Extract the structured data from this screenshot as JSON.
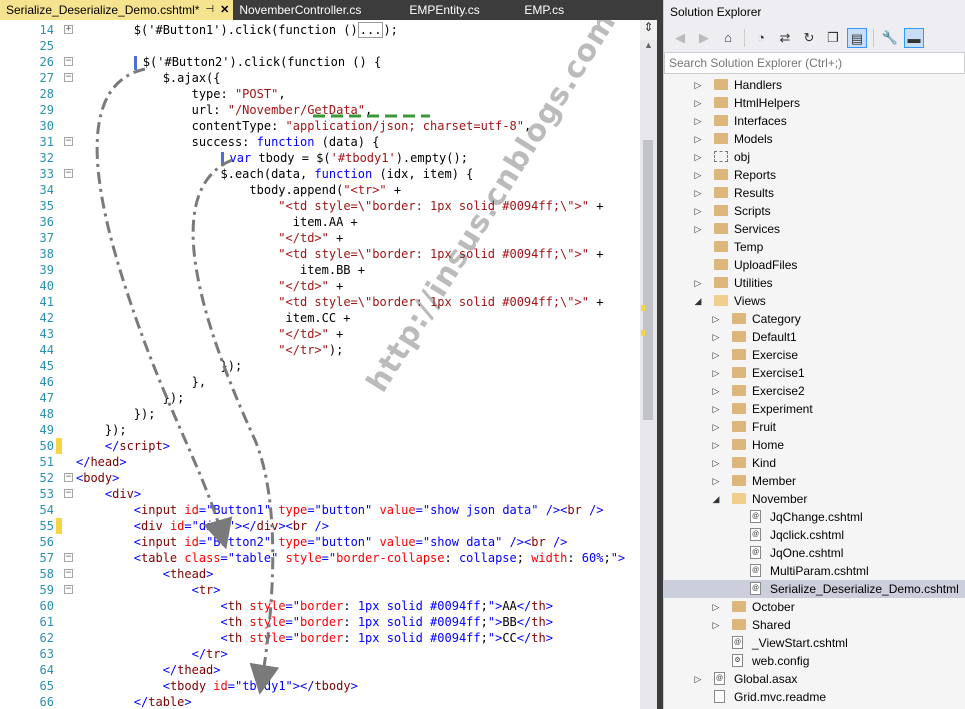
{
  "tabs": [
    {
      "label": "Serialize_Deserialize_Demo.cshtml*",
      "active": true
    },
    {
      "label": "NovemberController.cs"
    },
    {
      "label": "EMPEntity.cs"
    },
    {
      "label": "EMP.cs"
    }
  ],
  "editor": {
    "lines": [
      {
        "n": "14",
        "fold": "+",
        "html": "        $('#Button1').click(function ()<span class=\"box\">...</span>);"
      },
      {
        "n": "25",
        "fold": "",
        "html": ""
      },
      {
        "n": "26",
        "fold": "-",
        "html": "        <span class=\"caret\"></span>$('#Button2').click(function () {"
      },
      {
        "n": "27",
        "fold": "-",
        "html": "            $.ajax({"
      },
      {
        "n": "28",
        "fold": "",
        "html": "                type: <span class=\"s\">\"POST\"</span>,"
      },
      {
        "n": "29",
        "fold": "",
        "html": "                url: <span class=\"s\">\"/November/GetData\"</span>,"
      },
      {
        "n": "30",
        "fold": "",
        "html": "                contentType: <span class=\"s\">\"application/json; charset=utf-8\"</span>,"
      },
      {
        "n": "31",
        "fold": "-",
        "html": "                success: <span class=\"k\">function</span> (data) {"
      },
      {
        "n": "32",
        "fold": "",
        "html": "                    <span class=\"caret\"></span><span class=\"k\">var</span> tbody = $(<span class=\"s\">'#tbody1'</span>).empty();"
      },
      {
        "n": "33",
        "fold": "-",
        "html": "                    $.each(data, <span class=\"k\">function</span> (idx, item) {"
      },
      {
        "n": "34",
        "fold": "",
        "html": "                        tbody.append(<span class=\"s\">\"&lt;tr&gt;\"</span> +"
      },
      {
        "n": "35",
        "fold": "",
        "html": "                            <span class=\"s\">\"&lt;td style=\\\"border: 1px solid #0094ff;\\\"&gt;\"</span> +"
      },
      {
        "n": "36",
        "fold": "",
        "html": "                              item.AA +"
      },
      {
        "n": "37",
        "fold": "",
        "html": "                            <span class=\"s\">\"&lt;/td&gt;\"</span> +"
      },
      {
        "n": "38",
        "fold": "",
        "html": "                            <span class=\"s\">\"&lt;td style=\\\"border: 1px solid #0094ff;\\\"&gt;\"</span> +"
      },
      {
        "n": "39",
        "fold": "",
        "html": "                               item.BB +"
      },
      {
        "n": "40",
        "fold": "",
        "html": "                            <span class=\"s\">\"&lt;/td&gt;\"</span> +"
      },
      {
        "n": "41",
        "fold": "",
        "html": "                            <span class=\"s\">\"&lt;td style=\\\"border: 1px solid #0094ff;\\\"&gt;\"</span> +"
      },
      {
        "n": "42",
        "fold": "",
        "html": "                             item.CC +"
      },
      {
        "n": "43",
        "fold": "",
        "html": "                            <span class=\"s\">\"&lt;/td&gt;\"</span> +"
      },
      {
        "n": "44",
        "fold": "",
        "html": "                            <span class=\"s\">\"&lt;/tr&gt;\"</span>);"
      },
      {
        "n": "45",
        "fold": "",
        "html": "                    });"
      },
      {
        "n": "46",
        "fold": "",
        "html": "                },"
      },
      {
        "n": "47",
        "fold": "",
        "html": "            });"
      },
      {
        "n": "48",
        "fold": "",
        "html": "        });"
      },
      {
        "n": "49",
        "fold": "",
        "html": "    });"
      },
      {
        "n": "50",
        "fold": "",
        "mark": "#f5d547",
        "html": "    <span class=\"k\">&lt;/</span><span class=\"t\">script</span><span class=\"k\">&gt;</span>"
      },
      {
        "n": "51",
        "fold": "",
        "html": "<span class=\"k\">&lt;/</span><span class=\"t\">head</span><span class=\"k\">&gt;</span>"
      },
      {
        "n": "52",
        "fold": "-",
        "html": "<span class=\"k\">&lt;</span><span class=\"t\">body</span><span class=\"k\">&gt;</span>"
      },
      {
        "n": "53",
        "fold": "-",
        "html": "    <span class=\"k\">&lt;</span><span class=\"t\">div</span><span class=\"k\">&gt;</span>"
      },
      {
        "n": "54",
        "fold": "",
        "html": "        <span class=\"k\">&lt;</span><span class=\"t\">input</span> <span class=\"a\">id</span><span class=\"k\">=\"Button1\"</span> <span class=\"a\">type</span><span class=\"k\">=\"button\"</span> <span class=\"a\">value</span><span class=\"k\">=\"show json data\"</span> <span class=\"k\">/&gt;&lt;</span><span class=\"t\">br</span> <span class=\"k\">/&gt;</span>"
      },
      {
        "n": "55",
        "fold": "",
        "mark": "#f5d547",
        "html": "        <span class=\"k\">&lt;</span><span class=\"t\">div</span> <span class=\"a\">id</span><span class=\"k\">=\"div1\"&gt;&lt;/</span><span class=\"t\">div</span><span class=\"k\">&gt;&lt;</span><span class=\"t\">br</span> <span class=\"k\">/&gt;</span>"
      },
      {
        "n": "56",
        "fold": "",
        "html": "        <span class=\"k\">&lt;</span><span class=\"t\">input</span> <span class=\"a\">id</span><span class=\"k\">=\"Button2\"</span> <span class=\"a\">type</span><span class=\"k\">=\"button\"</span> <span class=\"a\">value</span><span class=\"k\">=\"show data\"</span> <span class=\"k\">/&gt;&lt;</span><span class=\"t\">br</span> <span class=\"k\">/&gt;</span>"
      },
      {
        "n": "57",
        "fold": "-",
        "html": "        <span class=\"k\">&lt;</span><span class=\"t\">table</span> <span class=\"a\">class</span><span class=\"k\">=\"table\"</span> <span class=\"a\">style</span><span class=\"k\">=\"</span><span class=\"a\">border-collapse</span>: <span class=\"k\">collapse</span>; <span class=\"a\">width</span>: <span class=\"k\">60%</span>;<span class=\"k\">\"&gt;</span>"
      },
      {
        "n": "58",
        "fold": "-",
        "html": "            <span class=\"k\">&lt;</span><span class=\"t\">thead</span><span class=\"k\">&gt;</span>"
      },
      {
        "n": "59",
        "fold": "-",
        "html": "                <span class=\"k\">&lt;</span><span class=\"t\">tr</span><span class=\"k\">&gt;</span>"
      },
      {
        "n": "60",
        "fold": "",
        "html": "                    <span class=\"k\">&lt;</span><span class=\"t\">th</span> <span class=\"a\">style</span><span class=\"k\">=\"</span><span class=\"a\">border</span>: <span class=\"k\">1px solid #0094ff</span>;<span class=\"k\">\"&gt;</span>AA<span class=\"k\">&lt;/</span><span class=\"t\">th</span><span class=\"k\">&gt;</span>"
      },
      {
        "n": "61",
        "fold": "",
        "html": "                    <span class=\"k\">&lt;</span><span class=\"t\">th</span> <span class=\"a\">style</span><span class=\"k\">=\"</span><span class=\"a\">border</span>: <span class=\"k\">1px solid #0094ff</span>;<span class=\"k\">\"&gt;</span>BB<span class=\"k\">&lt;/</span><span class=\"t\">th</span><span class=\"k\">&gt;</span>"
      },
      {
        "n": "62",
        "fold": "",
        "html": "                    <span class=\"k\">&lt;</span><span class=\"t\">th</span> <span class=\"a\">style</span><span class=\"k\">=\"</span><span class=\"a\">border</span>: <span class=\"k\">1px solid #0094ff</span>;<span class=\"k\">\"&gt;</span>CC<span class=\"k\">&lt;/</span><span class=\"t\">th</span><span class=\"k\">&gt;</span>"
      },
      {
        "n": "63",
        "fold": "",
        "html": "                <span class=\"k\">&lt;/</span><span class=\"t\">tr</span><span class=\"k\">&gt;</span>"
      },
      {
        "n": "64",
        "fold": "",
        "html": "            <span class=\"k\">&lt;/</span><span class=\"t\">thead</span><span class=\"k\">&gt;</span>"
      },
      {
        "n": "65",
        "fold": "",
        "html": "            <span class=\"k\">&lt;</span><span class=\"t\">tbody</span> <span class=\"a\">id</span><span class=\"k\">=\"tbody1\"&gt;&lt;/</span><span class=\"t\">tbody</span><span class=\"k\">&gt;</span>"
      },
      {
        "n": "66",
        "fold": "",
        "html": "        <span class=\"k\">&lt;/</span><span class=\"t\">table</span><span class=\"k\">&gt;</span>"
      }
    ]
  },
  "watermark": "http://insus.cnblogs.com",
  "solution_explorer": {
    "title": "Solution Explorer",
    "search_placeholder": "Search Solution Explorer (Ctrl+;)",
    "toolbar_icons": [
      "back-icon",
      "forward-icon",
      "home-icon",
      "history-icon",
      "sync-icon",
      "collapse-all-icon",
      "show-all-files-icon",
      "preview-icon",
      "properties-icon",
      "pin-icon"
    ],
    "items": [
      {
        "label": "Handlers",
        "type": "folder",
        "level": 0,
        "exp": "▷"
      },
      {
        "label": "HtmlHelpers",
        "type": "folder",
        "level": 0,
        "exp": "▷"
      },
      {
        "label": "Interfaces",
        "type": "folder",
        "level": 0,
        "exp": "▷"
      },
      {
        "label": "Models",
        "type": "folder",
        "level": 0,
        "exp": "▷"
      },
      {
        "label": "obj",
        "type": "dotted",
        "level": 0,
        "exp": "▷"
      },
      {
        "label": "Reports",
        "type": "folder",
        "level": 0,
        "exp": "▷"
      },
      {
        "label": "Results",
        "type": "folder",
        "level": 0,
        "exp": "▷"
      },
      {
        "label": "Scripts",
        "type": "folder",
        "level": 0,
        "exp": "▷"
      },
      {
        "label": "Services",
        "type": "folder",
        "level": 0,
        "exp": "▷"
      },
      {
        "label": "Temp",
        "type": "folder",
        "level": 0,
        "exp": ""
      },
      {
        "label": "UploadFiles",
        "type": "folder",
        "level": 0,
        "exp": ""
      },
      {
        "label": "Utilities",
        "type": "folder",
        "level": 0,
        "exp": "▷"
      },
      {
        "label": "Views",
        "type": "folder-open",
        "level": 0,
        "exp": "◢"
      },
      {
        "label": "Category",
        "type": "folder",
        "level": 1,
        "exp": "▷"
      },
      {
        "label": "Default1",
        "type": "folder",
        "level": 1,
        "exp": "▷"
      },
      {
        "label": "Exercise",
        "type": "folder",
        "level": 1,
        "exp": "▷"
      },
      {
        "label": "Exercise1",
        "type": "folder",
        "level": 1,
        "exp": "▷"
      },
      {
        "label": "Exercise2",
        "type": "folder",
        "level": 1,
        "exp": "▷"
      },
      {
        "label": "Experiment",
        "type": "folder",
        "level": 1,
        "exp": "▷"
      },
      {
        "label": "Fruit",
        "type": "folder",
        "level": 1,
        "exp": "▷"
      },
      {
        "label": "Home",
        "type": "folder",
        "level": 1,
        "exp": "▷"
      },
      {
        "label": "Kind",
        "type": "folder",
        "level": 1,
        "exp": "▷"
      },
      {
        "label": "Member",
        "type": "folder",
        "level": 1,
        "exp": "▷"
      },
      {
        "label": "November",
        "type": "folder-open",
        "level": 1,
        "exp": "◢"
      },
      {
        "label": "JqChange.cshtml",
        "type": "file",
        "level": 2,
        "exp": ""
      },
      {
        "label": "Jqclick.cshtml",
        "type": "file",
        "level": 2,
        "exp": ""
      },
      {
        "label": "JqOne.cshtml",
        "type": "file",
        "level": 2,
        "exp": ""
      },
      {
        "label": "MultiParam.cshtml",
        "type": "file",
        "level": 2,
        "exp": ""
      },
      {
        "label": "Serialize_Deserialize_Demo.cshtml",
        "type": "file",
        "level": 2,
        "exp": "",
        "selected": true
      },
      {
        "label": "October",
        "type": "folder",
        "level": 1,
        "exp": "▷"
      },
      {
        "label": "Shared",
        "type": "folder",
        "level": 1,
        "exp": "▷"
      },
      {
        "label": "_ViewStart.cshtml",
        "type": "file",
        "level": 1,
        "exp": ""
      },
      {
        "label": "web.config",
        "type": "config",
        "level": 1,
        "exp": ""
      },
      {
        "label": "Global.asax",
        "type": "file",
        "level": 0,
        "exp": "▷"
      },
      {
        "label": "Grid.mvc.readme",
        "type": "plain",
        "level": 0,
        "exp": ""
      }
    ]
  }
}
